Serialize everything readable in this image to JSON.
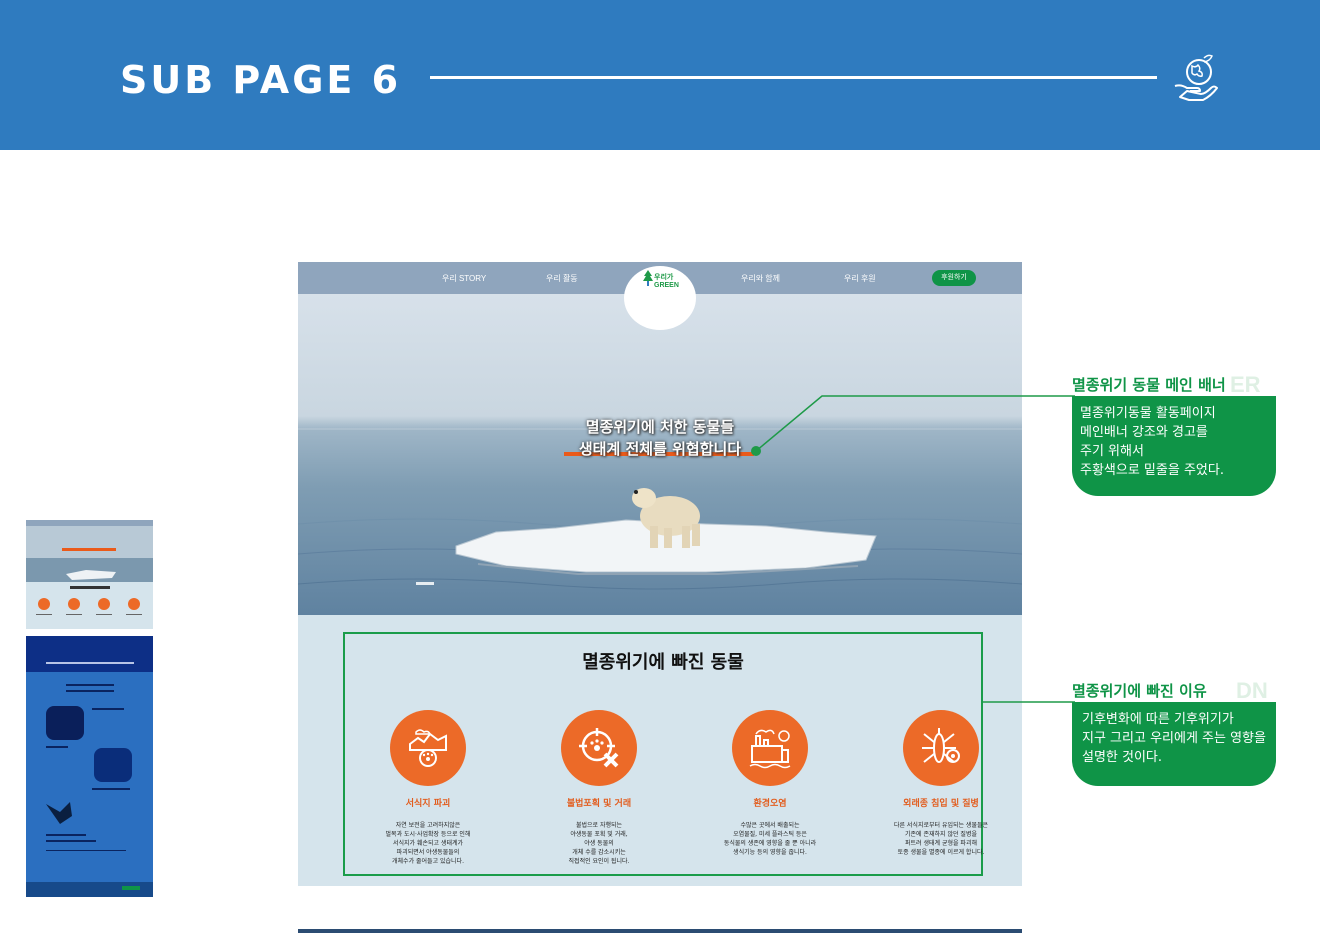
{
  "header": {
    "title": "SUB PAGE 6",
    "icon": "globe-in-hand-icon",
    "band_color": "#2f7bbf"
  },
  "mockup": {
    "nav": {
      "items": [
        "우리 STORY",
        "우리 활동",
        "우리와 함께",
        "우리 후원"
      ],
      "logo_line1": "우리가",
      "logo_line2": "GREEN",
      "donate_label": "후원하기"
    },
    "hero": {
      "line1": "멸종위기에 처한 동물들",
      "line2": "생태계 전체를 위협합니다"
    },
    "section": {
      "title": "멸종위기에 빠진 동물",
      "cards": [
        {
          "icon": "habitat-destruction-icon",
          "title": "서식지 파괴",
          "desc": "자연 보전을 고려하지않은\n벌목과 도시·사업확장 등으로 인해\n서식지가 훼손되고 생태계가\n파괴되면서 야생동물들의\n개체수가 줄어들고 있습니다."
        },
        {
          "icon": "illegal-hunting-icon",
          "title": "불법포획 및 거래",
          "desc": "불법으로 자행되는\n야생동물 포획 및 거래,\n야생 동물의\n개체 수를 감소시키는\n직접적인 요인이 됩니다."
        },
        {
          "icon": "pollution-icon",
          "title": "환경오염",
          "desc": "수많은 곳에서 배출되는\n오염물질, 미세 플라스틱 등은\n동식물의 생존에 영향을 줄 뿐 아니라\n생식기능 등의 영향을 줍니다."
        },
        {
          "icon": "invasive-species-icon",
          "title": "외래종 침입 및 질병",
          "desc": "다른 서식지로부터 유입되는 생물들은\n기존에 존재하지 않던 질병을\n퍼트려 생태계 균형을 파괴해\n토종 생물을 멸종에 이르게 합니다."
        }
      ]
    }
  },
  "callouts": [
    {
      "title": "멸종위기 동물 메인 배너",
      "ghost": "ER",
      "text": "멸종위기동물 활동페이지\n메인배너 강조와 경고를\n주기 위해서\n주황색으로 밑줄을 주었다."
    },
    {
      "title": "멸종위기에 빠진 이유",
      "ghost": "DN",
      "text": "기후변화에 따른 기후위기가\n지구 그리고 우리에게 주는 영향을\n설명한 것이다."
    }
  ],
  "colors": {
    "accent_green": "#0f9447",
    "accent_orange": "#ec6a28",
    "blue": "#2f7bbf"
  }
}
